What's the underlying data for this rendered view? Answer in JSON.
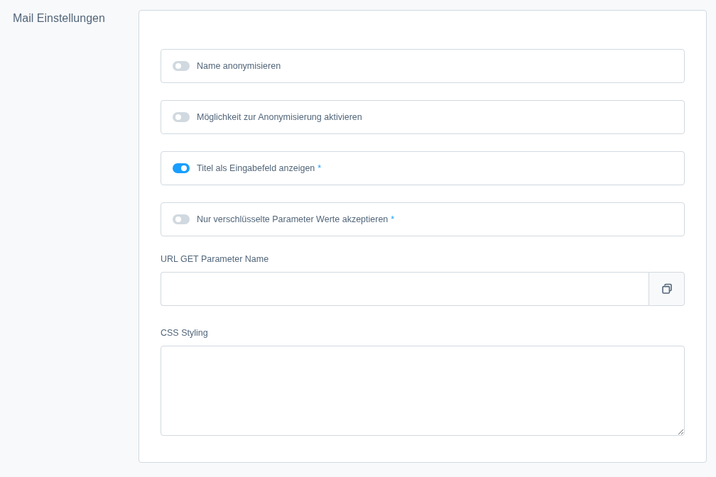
{
  "sidebar": {
    "title": "Mail Einstellungen"
  },
  "toggles": [
    {
      "label": "Name anonymisieren",
      "on": false
    },
    {
      "label": "Möglichkeit zur Anonymisierung aktivieren",
      "on": false
    },
    {
      "label": "Titel als Eingabefeld anzeigen",
      "on": true,
      "required_mark": "*"
    },
    {
      "label": "Nur verschlüsselte Parameter Werte akzeptieren",
      "on": false,
      "required_mark": "*"
    }
  ],
  "fields": [
    {
      "kind": "input_copy",
      "label": "URL GET Parameter Name"
    },
    {
      "kind": "textarea",
      "label": "CSS Styling"
    }
  ]
}
